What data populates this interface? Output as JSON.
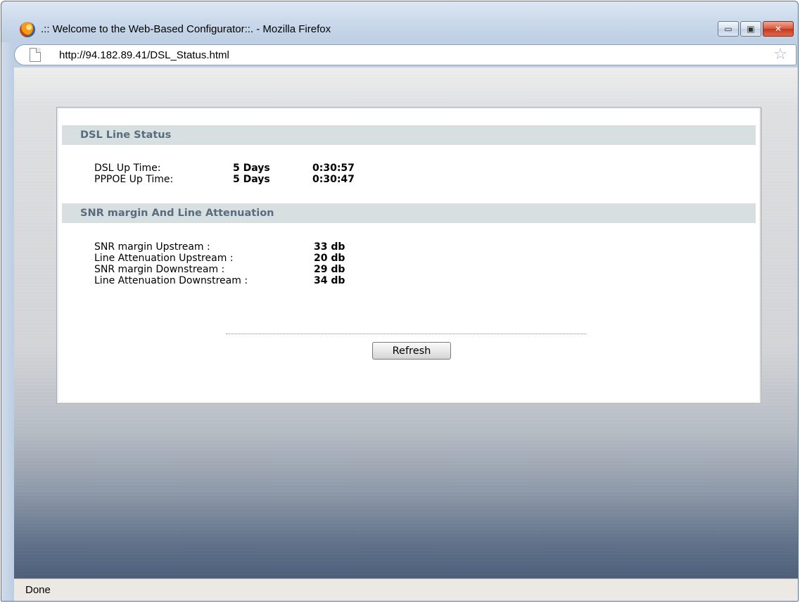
{
  "window": {
    "title": ".:: Welcome to the Web-Based Configurator::. - Mozilla Firefox",
    "minimize_glyph": "▭",
    "maximize_glyph": "▣",
    "close_glyph": "✕"
  },
  "addressbar": {
    "url": "http://94.182.89.41/DSL_Status.html",
    "star_glyph": "☆"
  },
  "page": {
    "line_status": {
      "header": "DSL Line Status",
      "rows": [
        {
          "label": "DSL Up Time:",
          "days": "5 Days",
          "time": "0:30:57"
        },
        {
          "label": "PPPOE Up Time:",
          "days": "5 Days",
          "time": "0:30:47"
        }
      ]
    },
    "snr": {
      "header": "SNR margin And Line Attenuation",
      "rows": [
        {
          "label": "SNR margin Upstream :",
          "value": "33 db"
        },
        {
          "label": "Line Attenuation Upstream :",
          "value": "20 db"
        },
        {
          "label": "SNR margin Downstream :",
          "value": "29 db"
        },
        {
          "label": "Line Attenuation Downstream :",
          "value": "34 db"
        }
      ]
    },
    "refresh_label": "Refresh"
  },
  "statusbar": {
    "text": "Done"
  },
  "colors": {
    "section_header_bg": "#d7dfe0",
    "section_header_text": "#596c7d"
  }
}
